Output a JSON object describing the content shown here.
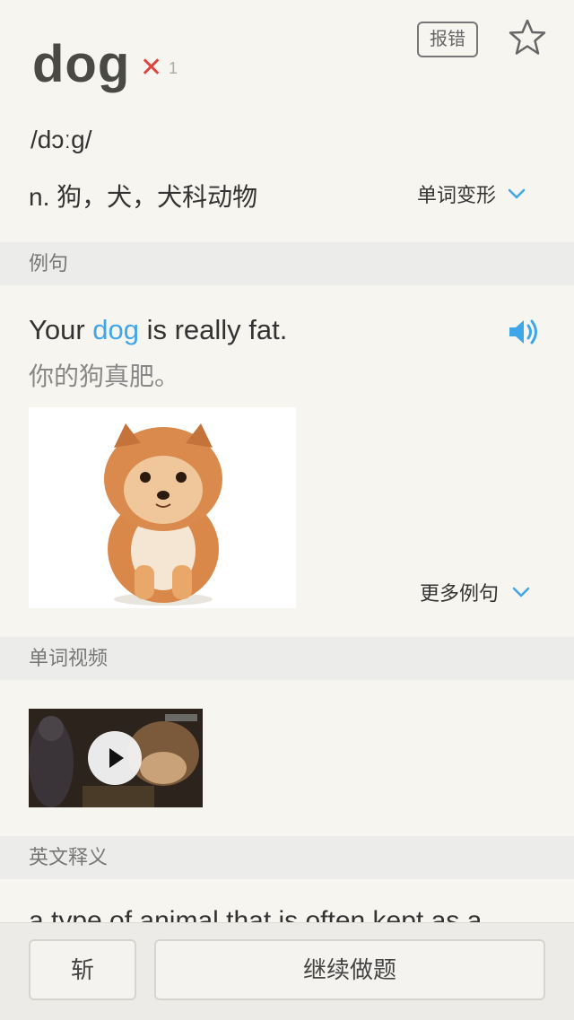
{
  "word": {
    "text": "dog",
    "wrong_mark": "✕",
    "wrong_count": "1",
    "report_label": "报错",
    "phonetic": "/dɔːg/",
    "definition": "n. 狗，犬，犬科动物",
    "variants_label": "单词变形"
  },
  "sections": {
    "examples": "例句",
    "video": "单词视频",
    "english_def": "英文释义"
  },
  "example": {
    "en_before": "Your ",
    "en_highlight": "dog",
    "en_after": " is really fat.",
    "zh": "你的狗真肥。",
    "more_label": "更多例句"
  },
  "english_definition": "a type of animal that is often kept as a",
  "bottom": {
    "kill_label": "斩",
    "continue_label": "继续做题"
  },
  "colors": {
    "accent": "#3fa6e8",
    "wrong": "#e0443e",
    "background": "#f7f5f0",
    "section_bg": "#ececea"
  },
  "icons": [
    "star-icon",
    "speaker-icon",
    "chevron-down-icon",
    "play-icon"
  ]
}
